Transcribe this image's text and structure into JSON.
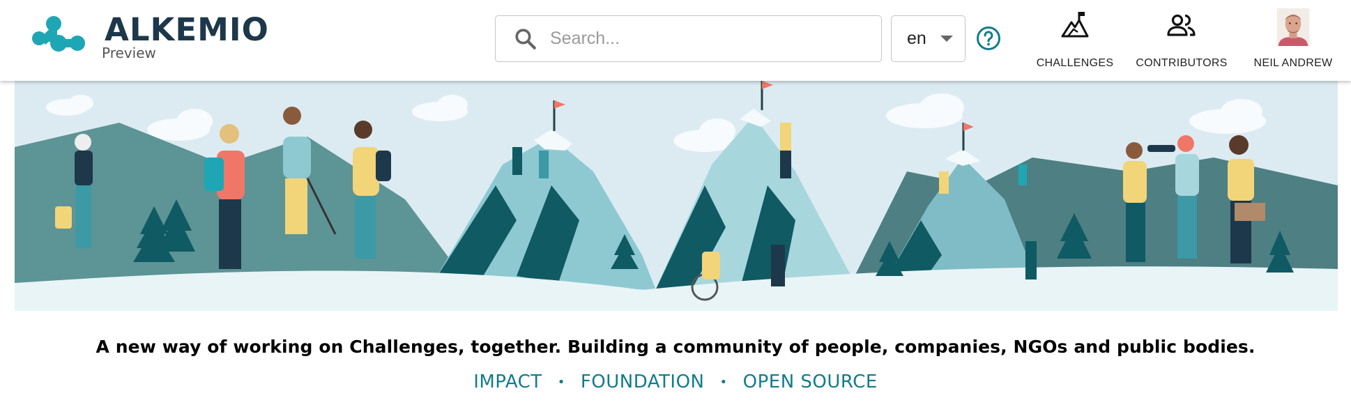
{
  "header": {
    "logo_name": "ALKEMIO",
    "logo_sub": "Preview",
    "search_placeholder": "Search...",
    "language": "en",
    "nav": {
      "challenges": "CHALLENGES",
      "contributors": "CONTRIBUTORS",
      "user": "NEIL ANDREW"
    }
  },
  "tagline": "A new way of working on Challenges, together. Building a community of people, companies, NGOs and public bodies.",
  "links": {
    "impact": "IMPACT",
    "foundation": "FOUNDATION",
    "open_source": "OPEN SOURCE",
    "separator": "•"
  },
  "colors": {
    "brand_teal": "#1ea6b5",
    "brand_dark": "#1d384a",
    "link": "#117c89",
    "sky": "#dcebf2",
    "mountain_dark": "#0f5a63",
    "mountain_light": "#8ec9d2"
  },
  "icons": {
    "logo": "alkemio-logo-icon",
    "search": "search-icon",
    "language_caret": "caret-down-icon",
    "help": "help-circle-icon",
    "challenges": "mountain-flag-icon",
    "contributors": "people-icon",
    "user": "avatar"
  }
}
